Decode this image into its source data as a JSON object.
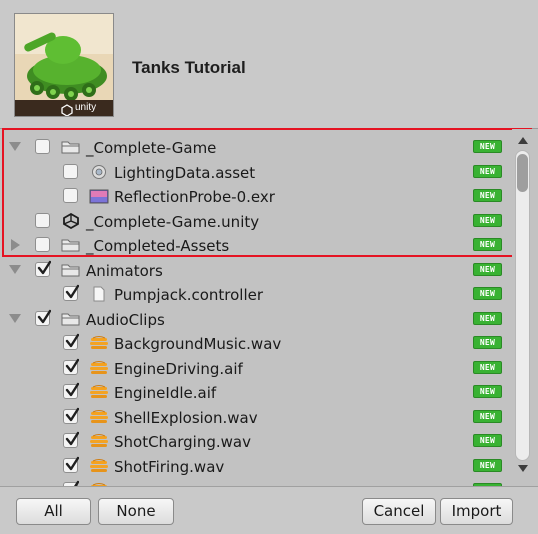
{
  "header": {
    "title": "Tanks Tutorial",
    "thumbnail_caption": "unity"
  },
  "badge_label": "NEW",
  "colors": {
    "highlight": "#e51322",
    "badge": "#39b233"
  },
  "items": [
    {
      "label": "_Complete-Game",
      "icon": "folder-icon",
      "checked": false,
      "expander": "down",
      "depth": 0
    },
    {
      "label": "LightingData.asset",
      "icon": "lighting-data-icon",
      "checked": false,
      "expander": "none",
      "depth": 1
    },
    {
      "label": "ReflectionProbe-0.exr",
      "icon": "image-file-icon",
      "checked": false,
      "expander": "none",
      "depth": 1
    },
    {
      "label": "_Complete-Game.unity",
      "icon": "unity-scene-icon",
      "checked": false,
      "expander": "none",
      "depth": 0
    },
    {
      "label": "_Completed-Assets",
      "icon": "folder-icon",
      "checked": false,
      "expander": "right",
      "depth": 0
    },
    {
      "label": "Animators",
      "icon": "folder-icon",
      "checked": true,
      "expander": "down",
      "depth": 0
    },
    {
      "label": "Pumpjack.controller",
      "icon": "file-icon",
      "checked": true,
      "expander": "none",
      "depth": 1
    },
    {
      "label": "AudioClips",
      "icon": "folder-icon",
      "checked": true,
      "expander": "down",
      "depth": 0
    },
    {
      "label": "BackgroundMusic.wav",
      "icon": "audio-clip-icon",
      "checked": true,
      "expander": "none",
      "depth": 1
    },
    {
      "label": "EngineDriving.aif",
      "icon": "audio-clip-icon",
      "checked": true,
      "expander": "none",
      "depth": 1
    },
    {
      "label": "EngineIdle.aif",
      "icon": "audio-clip-icon",
      "checked": true,
      "expander": "none",
      "depth": 1
    },
    {
      "label": "ShellExplosion.wav",
      "icon": "audio-clip-icon",
      "checked": true,
      "expander": "none",
      "depth": 1
    },
    {
      "label": "ShotCharging.wav",
      "icon": "audio-clip-icon",
      "checked": true,
      "expander": "none",
      "depth": 1
    },
    {
      "label": "ShotFiring.wav",
      "icon": "audio-clip-icon",
      "checked": true,
      "expander": "none",
      "depth": 1
    },
    {
      "label": "",
      "icon": "audio-clip-icon",
      "checked": true,
      "expander": "none",
      "depth": 1
    }
  ],
  "buttons": {
    "all": "All",
    "none": "None",
    "cancel": "Cancel",
    "import": "Import"
  }
}
